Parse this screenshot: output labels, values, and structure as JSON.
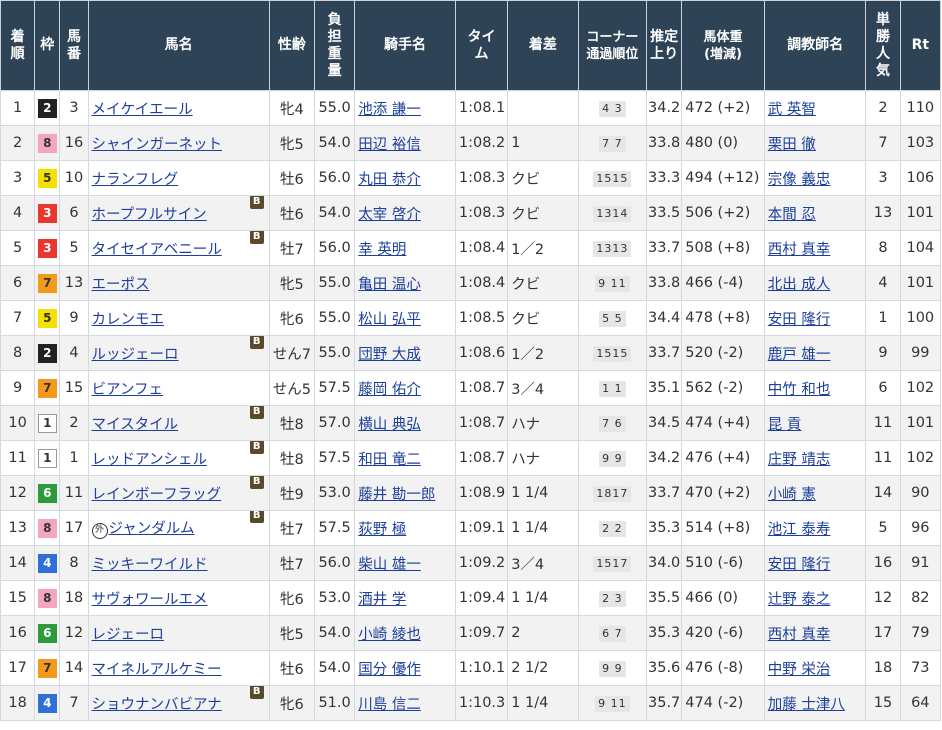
{
  "headers": {
    "rank": "着順",
    "waku": "枠",
    "umaban": "馬番",
    "horse": "馬名",
    "sexage": "性齢",
    "weight": "負担重量",
    "jockey": "騎手名",
    "time": "タイム",
    "margin": "着差",
    "corner": "コーナー通過順位",
    "last3f": "推定上り",
    "body": "馬体重(増減)",
    "trainer": "調教師名",
    "pop": "単勝人気",
    "rt": "Rt"
  },
  "waku_colors": {
    "1": {
      "bg": "#ffffff",
      "fg": "#333333",
      "border": "#999999"
    },
    "2": {
      "bg": "#222222",
      "fg": "#ffffff",
      "border": "#222222"
    },
    "3": {
      "bg": "#e8372e",
      "fg": "#ffffff",
      "border": "#e8372e"
    },
    "4": {
      "bg": "#2f6fd6",
      "fg": "#ffffff",
      "border": "#2f6fd6"
    },
    "5": {
      "bg": "#f5e100",
      "fg": "#333333",
      "border": "#f5e100"
    },
    "6": {
      "bg": "#2f9a3c",
      "fg": "#ffffff",
      "border": "#2f9a3c"
    },
    "7": {
      "bg": "#f39a1c",
      "fg": "#333333",
      "border": "#f39a1c"
    },
    "8": {
      "bg": "#f4a6bf",
      "fg": "#333333",
      "border": "#f4a6bf"
    }
  },
  "rows": [
    {
      "rank": "1",
      "waku": "2",
      "umaban": "3",
      "horse": "メイケイエール",
      "maru": "",
      "blinker": "",
      "sexage": "牝4",
      "weight": "55.0",
      "jockey": "池添 謙一",
      "time": "1:08.1",
      "margin": "",
      "corner": "4 3",
      "last3f": "34.2",
      "body": "472 (+2)",
      "trainer": "武 英智",
      "pop": "2",
      "rt": "110"
    },
    {
      "rank": "2",
      "waku": "8",
      "umaban": "16",
      "horse": "シャインガーネット",
      "maru": "",
      "blinker": "",
      "sexage": "牝5",
      "weight": "54.0",
      "jockey": "田辺 裕信",
      "time": "1:08.2",
      "margin": "1",
      "corner": "7 7",
      "last3f": "33.8",
      "body": "480 (0)",
      "trainer": "栗田 徹",
      "pop": "7",
      "rt": "103"
    },
    {
      "rank": "3",
      "waku": "5",
      "umaban": "10",
      "horse": "ナランフレグ",
      "maru": "",
      "blinker": "",
      "sexage": "牡6",
      "weight": "56.0",
      "jockey": "丸田 恭介",
      "time": "1:08.3",
      "margin": "クビ",
      "corner": "1515",
      "last3f": "33.3",
      "body": "494 (+12)",
      "trainer": "宗像 義忠",
      "pop": "3",
      "rt": "106"
    },
    {
      "rank": "4",
      "waku": "3",
      "umaban": "6",
      "horse": "ホープフルサイン",
      "maru": "",
      "blinker": "B",
      "sexage": "牡6",
      "weight": "54.0",
      "jockey": "太宰 啓介",
      "time": "1:08.3",
      "margin": "クビ",
      "corner": "1314",
      "last3f": "33.5",
      "body": "506 (+2)",
      "trainer": "本間 忍",
      "pop": "13",
      "rt": "101"
    },
    {
      "rank": "5",
      "waku": "3",
      "umaban": "5",
      "horse": "タイセイアベニール",
      "maru": "",
      "blinker": "B",
      "sexage": "牡7",
      "weight": "56.0",
      "jockey": "幸 英明",
      "time": "1:08.4",
      "margin": "1／2",
      "corner": "1313",
      "last3f": "33.7",
      "body": "508 (+8)",
      "trainer": "西村 真幸",
      "pop": "8",
      "rt": "104"
    },
    {
      "rank": "6",
      "waku": "7",
      "umaban": "13",
      "horse": "エーポス",
      "maru": "",
      "blinker": "",
      "sexage": "牝5",
      "weight": "55.0",
      "jockey": "亀田 温心",
      "time": "1:08.4",
      "margin": "クビ",
      "corner": "9 11",
      "last3f": "33.8",
      "body": "466 (-4)",
      "trainer": "北出 成人",
      "pop": "4",
      "rt": "101"
    },
    {
      "rank": "7",
      "waku": "5",
      "umaban": "9",
      "horse": "カレンモエ",
      "maru": "",
      "blinker": "",
      "sexage": "牝6",
      "weight": "55.0",
      "jockey": "松山 弘平",
      "time": "1:08.5",
      "margin": "クビ",
      "corner": "5 5",
      "last3f": "34.4",
      "body": "478 (+8)",
      "trainer": "安田 隆行",
      "pop": "1",
      "rt": "100"
    },
    {
      "rank": "8",
      "waku": "2",
      "umaban": "4",
      "horse": "ルッジェーロ",
      "maru": "",
      "blinker": "B",
      "sexage": "せん7",
      "weight": "55.0",
      "jockey": "団野 大成",
      "time": "1:08.6",
      "margin": "1／2",
      "corner": "1515",
      "last3f": "33.7",
      "body": "520 (-2)",
      "trainer": "鹿戸 雄一",
      "pop": "9",
      "rt": "99"
    },
    {
      "rank": "9",
      "waku": "7",
      "umaban": "15",
      "horse": "ビアンフェ",
      "maru": "",
      "blinker": "",
      "sexage": "せん5",
      "weight": "57.5",
      "jockey": "藤岡 佑介",
      "time": "1:08.7",
      "margin": "3／4",
      "corner": "1 1",
      "last3f": "35.1",
      "body": "562 (-2)",
      "trainer": "中竹 和也",
      "pop": "6",
      "rt": "102"
    },
    {
      "rank": "10",
      "waku": "1",
      "umaban": "2",
      "horse": "マイスタイル",
      "maru": "",
      "blinker": "B",
      "sexage": "牡8",
      "weight": "57.0",
      "jockey": "横山 典弘",
      "time": "1:08.7",
      "margin": "ハナ",
      "corner": "7 6",
      "last3f": "34.5",
      "body": "474 (+4)",
      "trainer": "昆 貢",
      "pop": "11",
      "rt": "101"
    },
    {
      "rank": "11",
      "waku": "1",
      "umaban": "1",
      "horse": "レッドアンシェル",
      "maru": "",
      "blinker": "B",
      "sexage": "牡8",
      "weight": "57.5",
      "jockey": "和田 竜二",
      "time": "1:08.7",
      "margin": "ハナ",
      "corner": "9 9",
      "last3f": "34.2",
      "body": "476 (+4)",
      "trainer": "庄野 靖志",
      "pop": "11",
      "rt": "102"
    },
    {
      "rank": "12",
      "waku": "6",
      "umaban": "11",
      "horse": "レインボーフラッグ",
      "maru": "",
      "blinker": "B",
      "sexage": "牡9",
      "weight": "53.0",
      "jockey": "藤井 勘一郎",
      "time": "1:08.9",
      "margin": "1 1/4",
      "corner": "1817",
      "last3f": "33.7",
      "body": "470 (+2)",
      "trainer": "小崎 憲",
      "pop": "14",
      "rt": "90"
    },
    {
      "rank": "13",
      "waku": "8",
      "umaban": "17",
      "horse": "ジャンダルム",
      "maru": "外",
      "blinker": "B",
      "sexage": "牡7",
      "weight": "57.5",
      "jockey": "荻野 極",
      "time": "1:09.1",
      "margin": "1 1/4",
      "corner": "2 2",
      "last3f": "35.3",
      "body": "514 (+8)",
      "trainer": "池江 泰寿",
      "pop": "5",
      "rt": "96"
    },
    {
      "rank": "14",
      "waku": "4",
      "umaban": "8",
      "horse": "ミッキーワイルド",
      "maru": "",
      "blinker": "",
      "sexage": "牡7",
      "weight": "56.0",
      "jockey": "柴山 雄一",
      "time": "1:09.2",
      "margin": "3／4",
      "corner": "1517",
      "last3f": "34.0",
      "body": "510 (-6)",
      "trainer": "安田 隆行",
      "pop": "16",
      "rt": "91"
    },
    {
      "rank": "15",
      "waku": "8",
      "umaban": "18",
      "horse": "サヴォワールエメ",
      "maru": "",
      "blinker": "",
      "sexage": "牝6",
      "weight": "53.0",
      "jockey": "酒井 学",
      "time": "1:09.4",
      "margin": "1 1/4",
      "corner": "2 3",
      "last3f": "35.5",
      "body": "466 (0)",
      "trainer": "辻野 泰之",
      "pop": "12",
      "rt": "82"
    },
    {
      "rank": "16",
      "waku": "6",
      "umaban": "12",
      "horse": "レジェーロ",
      "maru": "",
      "blinker": "",
      "sexage": "牝5",
      "weight": "54.0",
      "jockey": "小崎 綾也",
      "time": "1:09.7",
      "margin": "2",
      "corner": "6 7",
      "last3f": "35.3",
      "body": "420 (-6)",
      "trainer": "西村 真幸",
      "pop": "17",
      "rt": "79"
    },
    {
      "rank": "17",
      "waku": "7",
      "umaban": "14",
      "horse": "マイネルアルケミー",
      "maru": "",
      "blinker": "",
      "sexage": "牡6",
      "weight": "54.0",
      "jockey": "国分 優作",
      "time": "1:10.1",
      "margin": "2 1/2",
      "corner": "9 9",
      "last3f": "35.6",
      "body": "476 (-8)",
      "trainer": "中野 栄治",
      "pop": "18",
      "rt": "73"
    },
    {
      "rank": "18",
      "waku": "4",
      "umaban": "7",
      "horse": "ショウナンバビアナ",
      "maru": "",
      "blinker": "B",
      "sexage": "牝6",
      "weight": "51.0",
      "jockey": "川島 信二",
      "time": "1:10.3",
      "margin": "1 1/4",
      "corner": "9 11",
      "last3f": "35.7",
      "body": "474 (-2)",
      "trainer": "加藤 士津八",
      "pop": "15",
      "rt": "64"
    }
  ]
}
